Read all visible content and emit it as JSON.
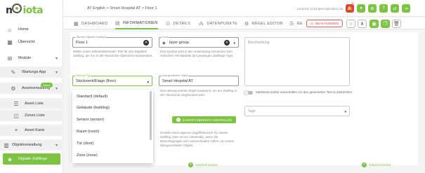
{
  "app": {
    "logo_main": "n",
    "logo_suffix": "iota",
    "breadcrumb": "AT English > Smart Hospital AT > Floor 1",
    "user_email": "DENISA.VLAD@SIGMUNDO.DE",
    "notification_count": "99"
  },
  "colors": {
    "accent": "#7cc243",
    "danger": "#e04040"
  },
  "sidebar": {
    "items": [
      {
        "label": "Home",
        "icon": "home-icon"
      },
      {
        "label": "Übersicht",
        "icon": "tiles-icon"
      },
      {
        "label": "Module",
        "icon": "grid-icon"
      },
      {
        "label": "Wartungs App",
        "icon": "wrench-icon"
      },
      {
        "label": "Assetverwaltung",
        "icon": "gear-icon",
        "badge": "Demo"
      },
      {
        "label": "Asset Liste",
        "icon": "list-icon"
      },
      {
        "label": "Zonen Liste",
        "icon": "zones-icon"
      },
      {
        "label": "Asset Karte",
        "icon": "map-icon"
      },
      {
        "label": "Objektverwaltung",
        "icon": "building-icon"
      },
      {
        "label": "Digitale Zwillinge",
        "icon": "twin-icon"
      }
    ]
  },
  "tabs": [
    {
      "label": "DASHBOARD",
      "icon": "dashboard-icon"
    },
    {
      "label": "INFORMATIONEN",
      "icon": "info-icon"
    },
    {
      "label": "DETAILS",
      "icon": "details-icon"
    },
    {
      "label": "DATENPUNKTE",
      "icon": "datapoints-icon"
    },
    {
      "label": "REGEL EDITOR",
      "icon": "rules-icon"
    },
    {
      "label": "RE",
      "icon": "more-icon"
    }
  ],
  "toolbar": {
    "deactivate_label": "DEAKTIVIEREN"
  },
  "form": {
    "name": {
      "label": "Titel des Digitalen Zwillings",
      "value": "Floor 1",
      "helper": "Wähle einen selbsterklärenden Titel für den Digitalen Zwilling, der ihn in der Hierarchie-Übersicht repräsentiert."
    },
    "icon": {
      "label": "Icons",
      "value": "layer-group",
      "helper": "Das Symbol wird in der Anwendung verwendet zum einfachen Verständnis des jeweiligen Zwillings-Typs."
    },
    "type": {
      "label": "Zwillings-Typ",
      "value": "Stockwerk/Etage (floor)"
    },
    "parent": {
      "label": "Übergeordnetes Objekt",
      "value": "Smart Hospital AT",
      "helper": "Das übergeordnete Objekt bestimmt, wo der Zwilling in der Hierarchie eingeordnet wird."
    },
    "access_button": "ZUGRIFFSBEREICH ERSTELLEN",
    "access_helper": "Erstelle einen eigenen Zugriffsbereich für diesen Zwilling. Dies ist nur notwendig, wenn die Berechtigungen sich unterscheiden sollen von einem übergeordneten Objekt.",
    "description_placeholder": "Beschreibung",
    "markdown_toggle": "Markdown Editor ausschalten um den generierten Text zu betrachten.",
    "tags_placeholder": "Tags",
    "add_label_1": "HINZUFÜGEN",
    "add_label_2": "HINZUFÜGEN"
  },
  "dropdown": {
    "options": [
      "Standard (default)",
      "Gebäude (building)",
      "Sensor (sensor)",
      "Raum (room)",
      "Tür (door)",
      "Zone (zone)"
    ]
  }
}
